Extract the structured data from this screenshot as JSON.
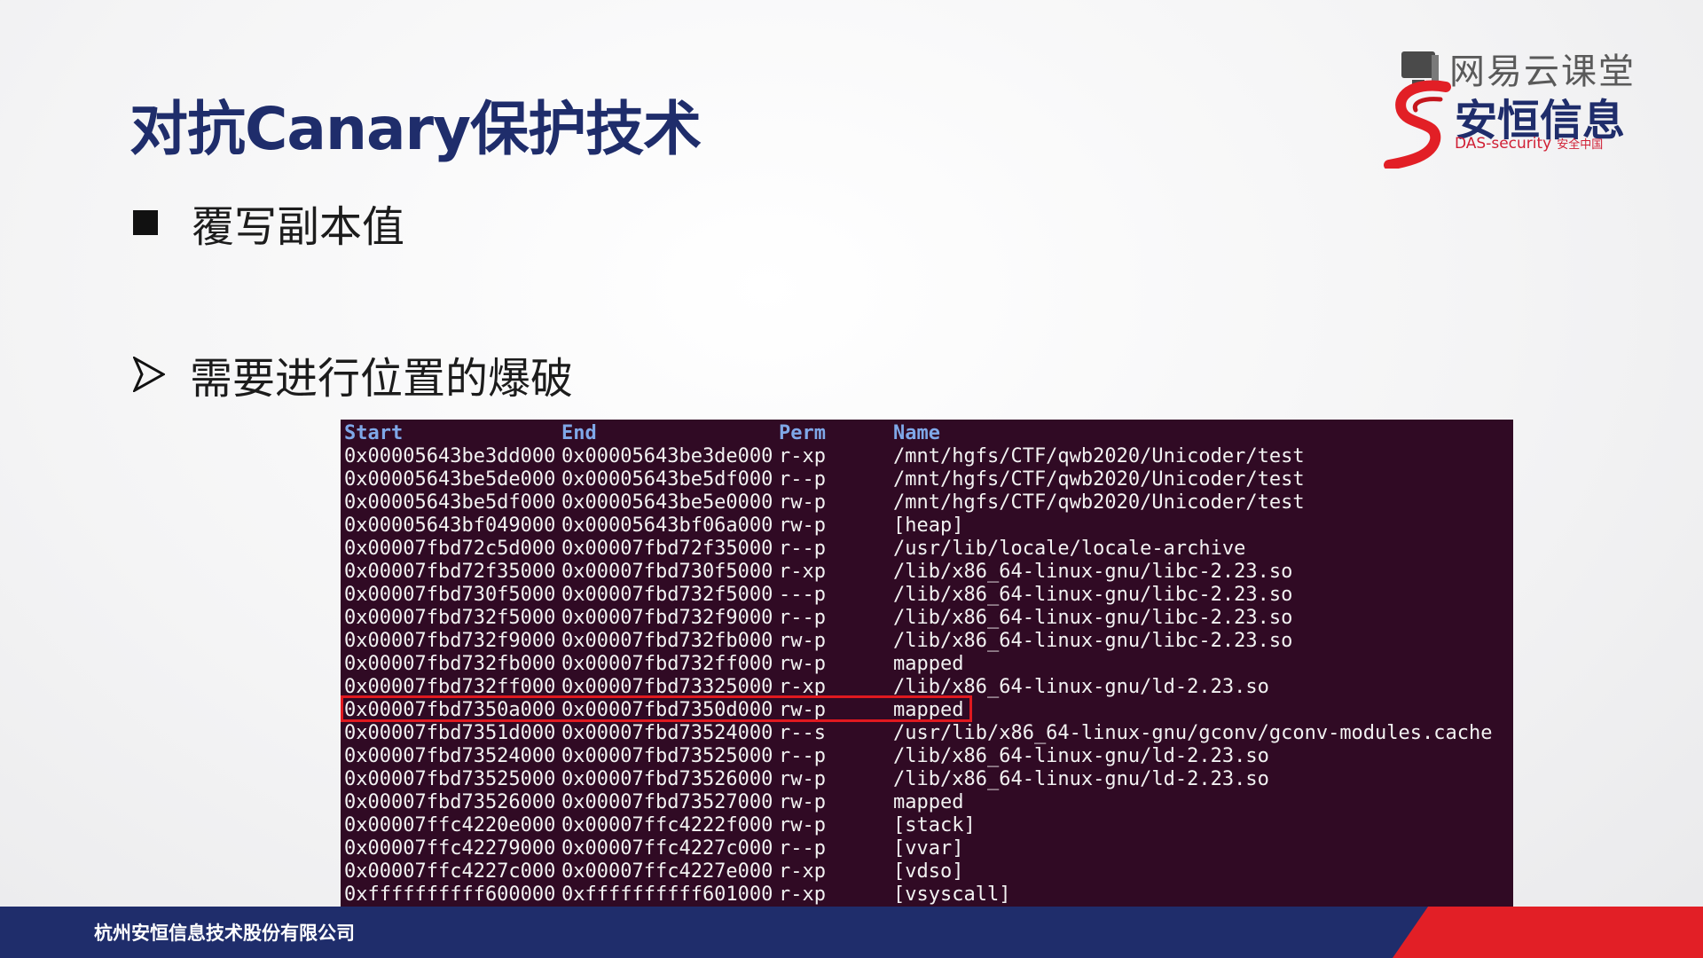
{
  "title": "对抗Canary保护技术",
  "bullets": [
    {
      "icon": "square-bullet-icon",
      "text": "覆写副本值"
    },
    {
      "icon": "arrow-bullet-icon",
      "text": "需要进行位置的爆破"
    }
  ],
  "logo": {
    "netease": "网易云课堂",
    "brand": "安恒信息",
    "tagline": "DAS-security",
    "tagline_cn": "安全中国"
  },
  "terminal": {
    "headers": [
      "Start",
      "End",
      "Perm",
      "Name"
    ],
    "rows": [
      [
        "0x00005643be3dd000",
        "0x00005643be3de000",
        "r-xp",
        "/mnt/hgfs/CTF/qwb2020/Unicoder/test"
      ],
      [
        "0x00005643be5de000",
        "0x00005643be5df000",
        "r--p",
        "/mnt/hgfs/CTF/qwb2020/Unicoder/test"
      ],
      [
        "0x00005643be5df000",
        "0x00005643be5e0000",
        "rw-p",
        "/mnt/hgfs/CTF/qwb2020/Unicoder/test"
      ],
      [
        "0x00005643bf049000",
        "0x00005643bf06a000",
        "rw-p",
        "[heap]"
      ],
      [
        "0x00007fbd72c5d000",
        "0x00007fbd72f35000",
        "r--p",
        "/usr/lib/locale/locale-archive"
      ],
      [
        "0x00007fbd72f35000",
        "0x00007fbd730f5000",
        "r-xp",
        "/lib/x86_64-linux-gnu/libc-2.23.so"
      ],
      [
        "0x00007fbd730f5000",
        "0x00007fbd732f5000",
        "---p",
        "/lib/x86_64-linux-gnu/libc-2.23.so"
      ],
      [
        "0x00007fbd732f5000",
        "0x00007fbd732f9000",
        "r--p",
        "/lib/x86_64-linux-gnu/libc-2.23.so"
      ],
      [
        "0x00007fbd732f9000",
        "0x00007fbd732fb000",
        "rw-p",
        "/lib/x86_64-linux-gnu/libc-2.23.so"
      ],
      [
        "0x00007fbd732fb000",
        "0x00007fbd732ff000",
        "rw-p",
        "mapped"
      ],
      [
        "0x00007fbd732ff000",
        "0x00007fbd73325000",
        "r-xp",
        "/lib/x86_64-linux-gnu/ld-2.23.so"
      ],
      [
        "0x00007fbd7350a000",
        "0x00007fbd7350d000",
        "rw-p",
        "mapped"
      ],
      [
        "0x00007fbd7351d000",
        "0x00007fbd73524000",
        "r--s",
        "/usr/lib/x86_64-linux-gnu/gconv/gconv-modules.cache"
      ],
      [
        "0x00007fbd73524000",
        "0x00007fbd73525000",
        "r--p",
        "/lib/x86_64-linux-gnu/ld-2.23.so"
      ],
      [
        "0x00007fbd73525000",
        "0x00007fbd73526000",
        "rw-p",
        "/lib/x86_64-linux-gnu/ld-2.23.so"
      ],
      [
        "0x00007fbd73526000",
        "0x00007fbd73527000",
        "rw-p",
        "mapped"
      ],
      [
        "0x00007ffc4220e000",
        "0x00007ffc4222f000",
        "rw-p",
        "[stack]"
      ],
      [
        "0x00007ffc42279000",
        "0x00007ffc4227c000",
        "r--p",
        "[vvar]"
      ],
      [
        "0x00007ffc4227c000",
        "0x00007ffc4227e000",
        "r-xp",
        "[vdso]"
      ],
      [
        "0xffffffffff600000",
        "0xffffffffff601000",
        "r-xp",
        "[vsyscall]"
      ]
    ],
    "highlight_row": 11,
    "colors": {
      "background": "#300a24",
      "header": "#7fa8e8",
      "text": "#f2f2f2",
      "highlight": "#e0191f"
    }
  },
  "footer": {
    "company": "杭州安恒信息技术股份有限公司",
    "colors": {
      "blue": "#1f2d6b",
      "red": "#e21f26"
    }
  }
}
